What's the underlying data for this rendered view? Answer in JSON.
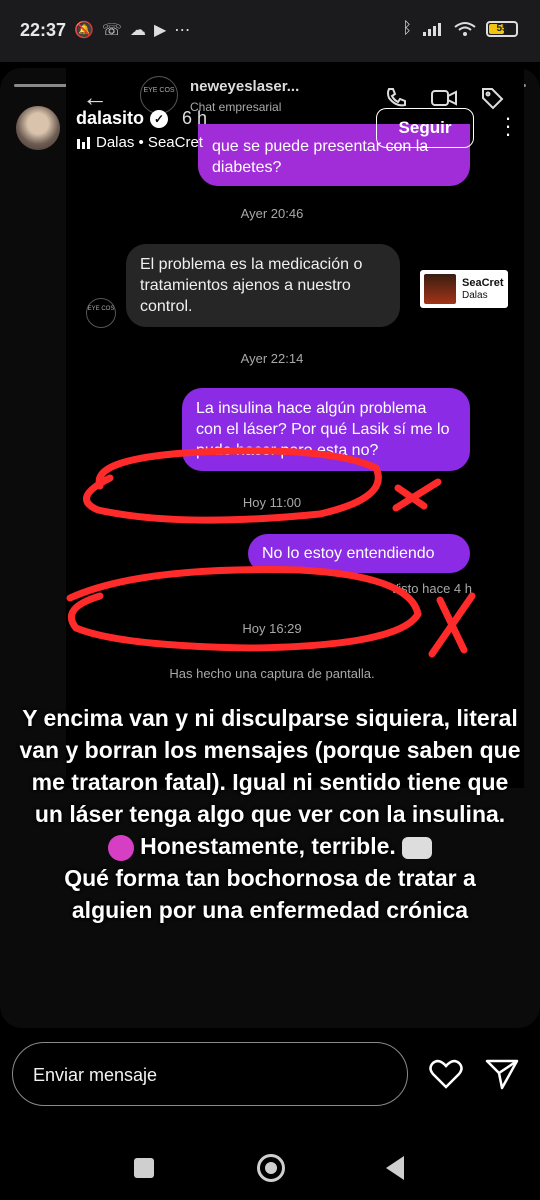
{
  "status_bar": {
    "time": "22:37",
    "left_icons": [
      "mute-icon",
      "missed-call-icon",
      "cloud-icon",
      "youtube-icon",
      "more-dots"
    ],
    "battery": "55"
  },
  "dm": {
    "contact_name": "neweyeslaser...",
    "contact_subtitle": "Chat empresarial",
    "avatar_text": "EYE COS",
    "messages": [
      {
        "text": "que se puede presentar con la diabetes?"
      },
      {
        "timestamp": "Ayer 20:46"
      },
      {
        "text": "El problema es la medicación o tratamientos ajenos a nuestro control."
      },
      {
        "timestamp": "Ayer 22:14"
      },
      {
        "text": "La insulina hace algún problema con el láser? Por qué Lasik sí me lo pude hacer pero esta no?"
      },
      {
        "timestamp": "Hoy 11:00"
      },
      {
        "text": "No lo estoy entendiendo"
      },
      {
        "timestamp": "Hoy 16:29"
      }
    ],
    "seen": "Visto hace 4 h",
    "screenshot_note": "Has hecho una captura de pantalla."
  },
  "music_sticker": {
    "title": "SeaCret",
    "artist": "Dalas"
  },
  "story_header": {
    "username": "dalasito",
    "time_ago": "6 h",
    "music": "Dalas • SeaCret",
    "follow_label": "Seguir"
  },
  "caption": {
    "lines": [
      "Y encima van y ni disculparse siquiera, literal",
      "van y borran los mensajes (porque saben que",
      "me trataron fatal). Igual ni sentido tiene que",
      "un láser tenga algo que ver con la insulina.",
      "Honestamente, terrible.",
      "Qué forma tan bochornosa de tratar a",
      "alguien por una enfermedad crónica"
    ]
  },
  "reply_bar": {
    "placeholder": "Enviar mensaje"
  },
  "colors": {
    "outgoing_bubble": "#8b2be6",
    "incoming_bubble": "#262626",
    "scribble": "#ff2a2a"
  }
}
